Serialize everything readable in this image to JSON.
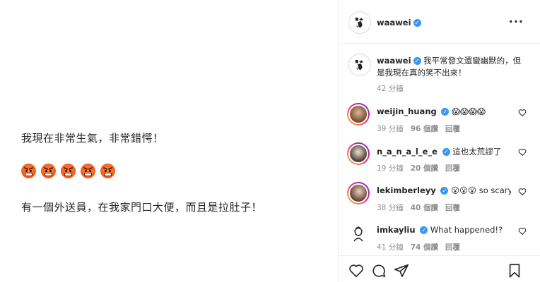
{
  "post": {
    "line1": "我現在非常生氣，非常錯愕！",
    "emoji_row": [
      "angry-face",
      "angry-face",
      "angry-face",
      "angry-face",
      "angry-face"
    ],
    "line3": "有一個外送員，在我家門口大便，而且是拉肚子！"
  },
  "header": {
    "username": "waawei",
    "verified": true
  },
  "caption": {
    "username": "waawei",
    "text": "我平常發文還蠻幽默的，但是我現在真的笑不出來！",
    "time": "42 分鐘"
  },
  "comments": [
    {
      "username": "weijin_huang",
      "text": "😱😱😱😱",
      "time": "39 分鐘",
      "likes": "96 個讚",
      "reply": "回覆"
    },
    {
      "username": "n_a_n_a_l_e_e",
      "text": "這也太荒謬了",
      "time": "19 分鐘",
      "likes": "20 個讚",
      "reply": "回覆"
    },
    {
      "username": "lekimberleyy",
      "text": "😮😮😮 so scary",
      "time": "38 分鐘",
      "likes": "40 個讚",
      "reply": "回覆"
    },
    {
      "username": "imkayliu",
      "text": "What happened!?",
      "time": "41 分鐘",
      "likes": "74 個讚",
      "reply": "回覆"
    }
  ],
  "icons": {
    "more": "more-options-icon",
    "like": "heart-icon",
    "comment": "comment-icon",
    "share": "share-icon",
    "save": "bookmark-icon"
  },
  "colors": {
    "verified": "#3897f0",
    "muted": "#8e8e8e",
    "text": "#262626"
  }
}
